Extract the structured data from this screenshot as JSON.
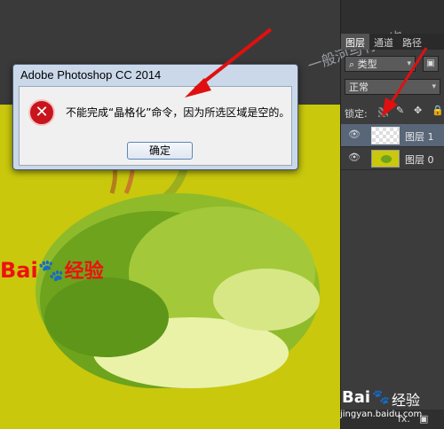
{
  "dialog": {
    "title": "Adobe Photoshop CC 2014",
    "message": "不能完成“晶格化”命令，因为所选区域是空的。",
    "ok_label": "确定"
  },
  "layers_panel": {
    "tabs": [
      "图层",
      "通道",
      "路径"
    ],
    "filter_label": "类型",
    "blend_mode": "正常",
    "lock_label": "锁定:",
    "layers": [
      {
        "name": "图层 1",
        "selected": true
      },
      {
        "name": "图层 0",
        "selected": false
      }
    ],
    "fx_label": "fx."
  },
  "watermarks": {
    "baidu_left_latin": "Bai",
    "baidu_left_cn": "经验",
    "baidu_bottom": "Bai",
    "baidu_bottom_cn": "经验",
    "baidu_bottom_url": "jingyan.baidu.com",
    "top_right": "一般河与竹相约"
  },
  "colors": {
    "canvas_bg": "#c8c90e",
    "dialog_title_bg": "#cad8ea",
    "selected_layer": "#596678",
    "arrow": "#e01010"
  }
}
